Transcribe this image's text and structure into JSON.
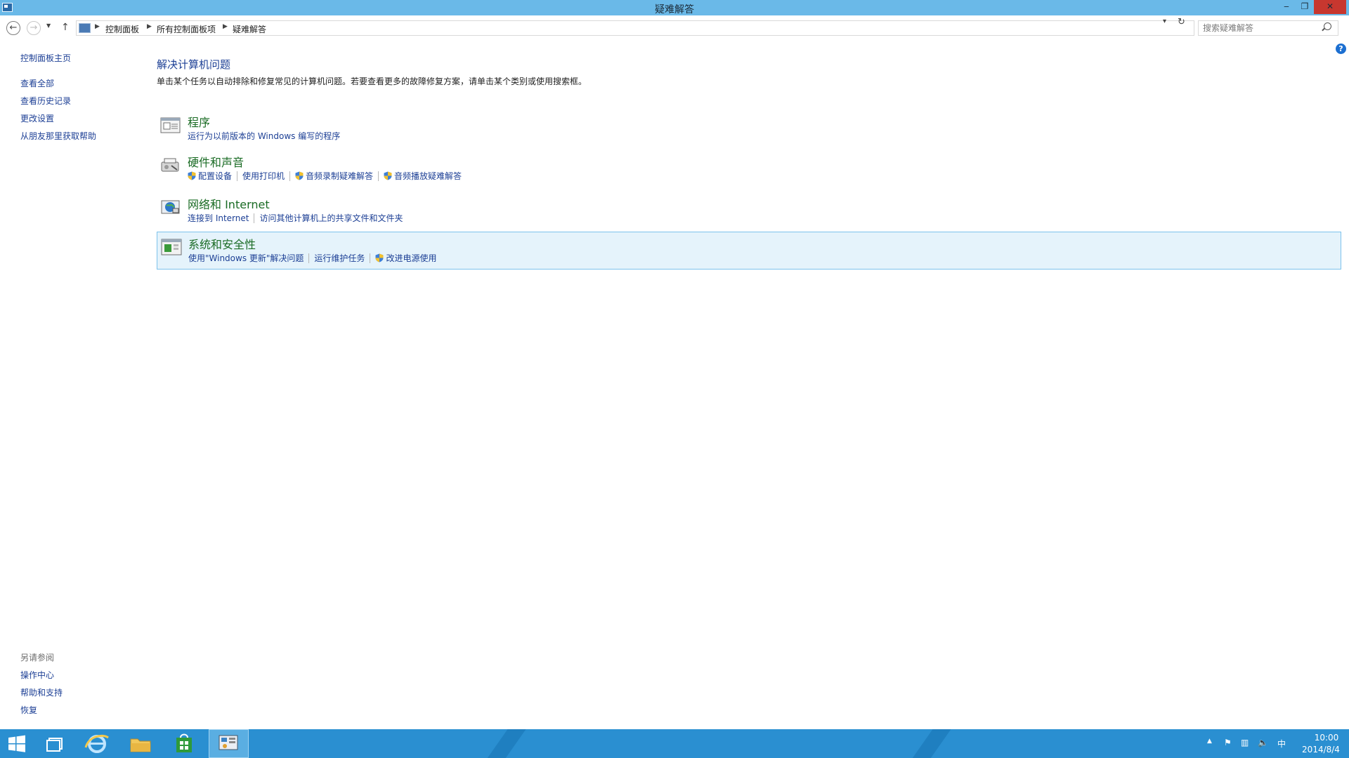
{
  "window": {
    "title": "疑难解答",
    "minimize_label": "‒",
    "maximize_label": "❐",
    "close_label": "✕"
  },
  "address_bar": {
    "breadcrumbs": [
      "控制面板",
      "所有控制面板项",
      "疑难解答"
    ],
    "search_placeholder": "搜索疑难解答"
  },
  "sidebar": {
    "home_link": "控制面板主页",
    "links": [
      "查看全部",
      "查看历史记录",
      "更改设置",
      "从朋友那里获取帮助"
    ],
    "see_also_heading": "另请参阅",
    "see_also_links": [
      "操作中心",
      "帮助和支持",
      "恢复"
    ]
  },
  "main": {
    "title": "解决计算机问题",
    "description": "单击某个任务以自动排除和修复常见的计算机问题。若要查看更多的故障修复方案，请单击某个类别或使用搜索框。",
    "categories": [
      {
        "title": "程序",
        "icon": "programs-icon",
        "links": [
          {
            "label": "运行为以前版本的 Windows 编写的程序",
            "shield": false
          }
        ]
      },
      {
        "title": "硬件和声音",
        "icon": "hardware-sound-icon",
        "links": [
          {
            "label": "配置设备",
            "shield": true
          },
          {
            "label": "使用打印机",
            "shield": false
          },
          {
            "label": "音频录制疑难解答",
            "shield": true
          },
          {
            "label": "音频播放疑难解答",
            "shield": true
          }
        ]
      },
      {
        "title": "网络和 Internet",
        "icon": "network-internet-icon",
        "links": [
          {
            "label": "连接到 Internet",
            "shield": false
          },
          {
            "label": "访问其他计算机上的共享文件和文件夹",
            "shield": false
          }
        ]
      },
      {
        "title": "系统和安全性",
        "icon": "system-security-icon",
        "selected": true,
        "links": [
          {
            "label": "使用\"Windows 更新\"解决问题",
            "shield": false
          },
          {
            "label": "运行维护任务",
            "shield": false
          },
          {
            "label": "改进电源使用",
            "shield": true
          }
        ]
      }
    ]
  },
  "taskbar": {
    "apps": [
      "start-button",
      "task-view",
      "internet-explorer",
      "file-explorer",
      "windows-store",
      "control-panel"
    ],
    "active_app": "control-panel",
    "tray": {
      "ime_label": "中",
      "time": "10:00",
      "date": "2014/8/4"
    }
  },
  "colors": {
    "titlebar": "#6ab9e8",
    "link": "#1c3f95",
    "category_title": "#1a6b24",
    "selection_bg": "#e5f3fb",
    "selection_border": "#7dc2ec",
    "taskbar": "#2a8fd1",
    "close_button": "#c7372f"
  }
}
